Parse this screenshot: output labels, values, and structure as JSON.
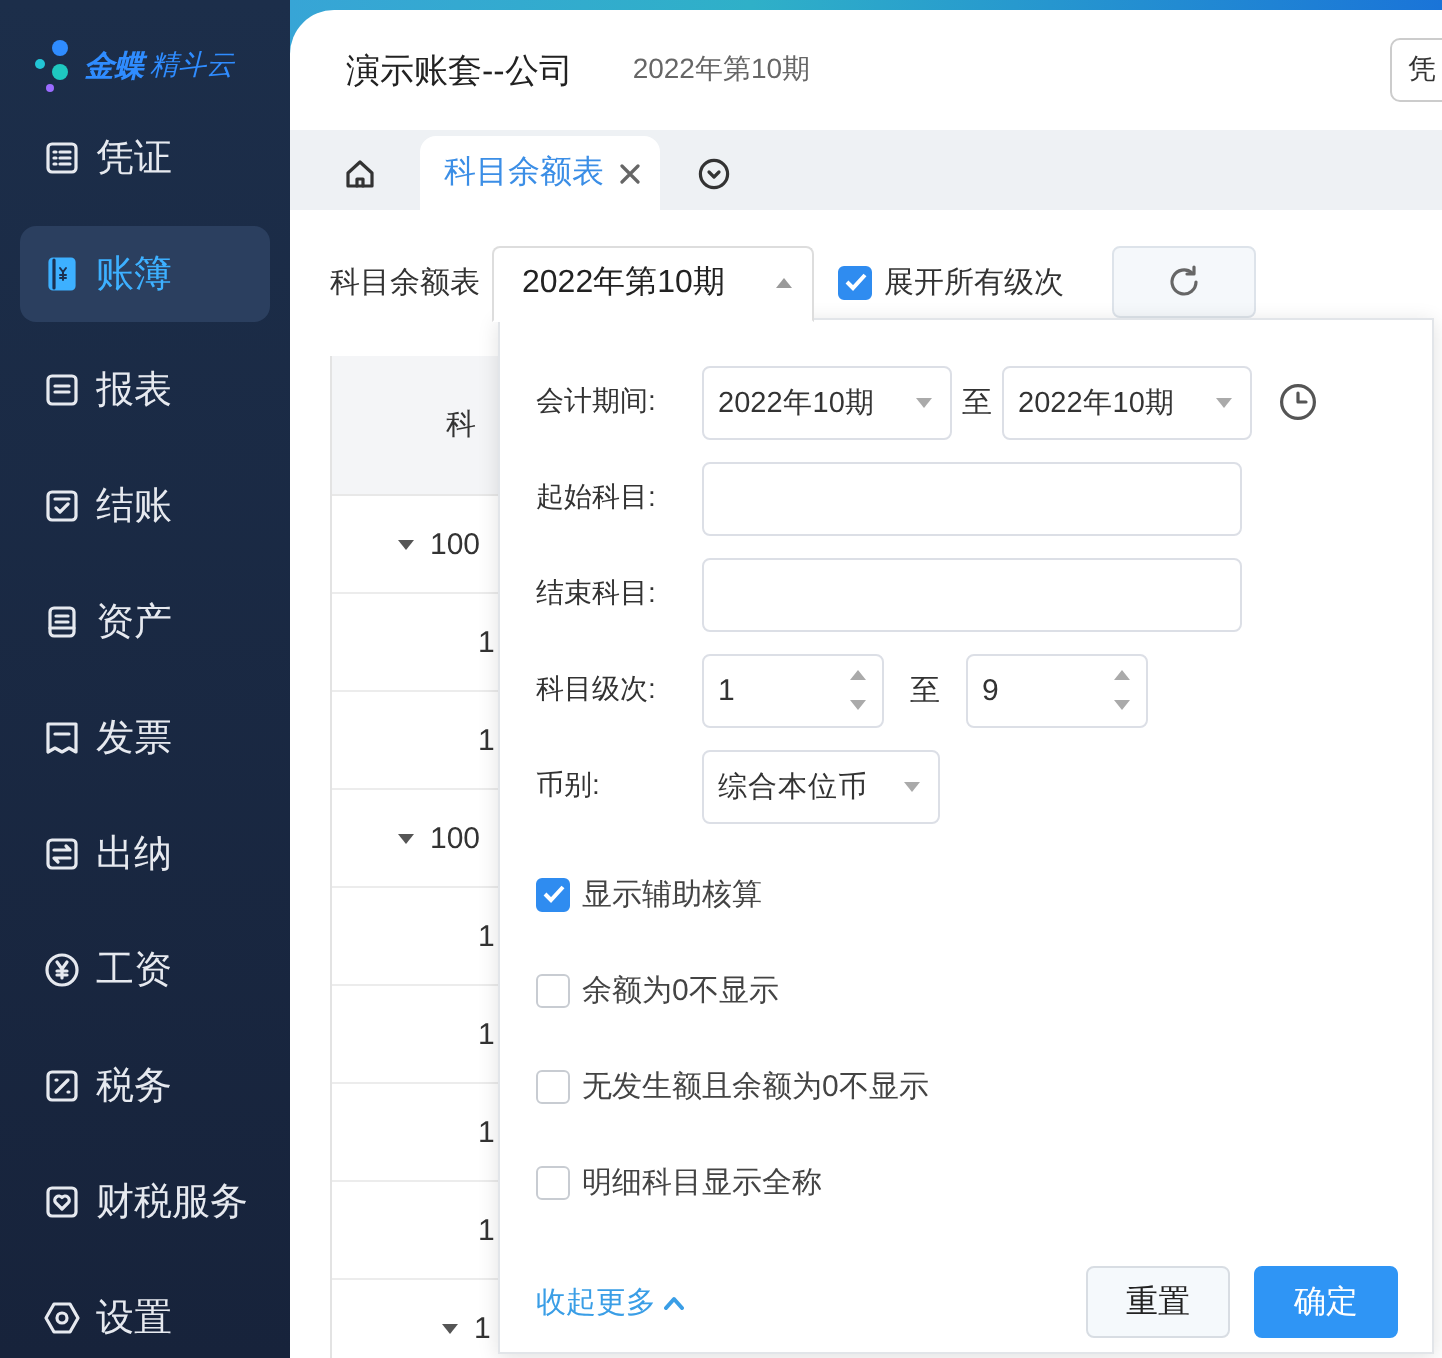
{
  "sidebar": {
    "logo": {
      "brand": "金蝶",
      "product": "精斗云"
    },
    "items": [
      {
        "label": "凭证",
        "kind": "list",
        "selected": false
      },
      {
        "label": "账簿",
        "kind": "book",
        "selected": true
      },
      {
        "label": "报表",
        "kind": "lines",
        "selected": false
      },
      {
        "label": "结账",
        "kind": "check",
        "selected": false
      },
      {
        "label": "资产",
        "kind": "doc",
        "selected": false
      },
      {
        "label": "发票",
        "kind": "receipt",
        "selected": false
      },
      {
        "label": "出纳",
        "kind": "swap",
        "selected": false
      },
      {
        "label": "工资",
        "kind": "yen",
        "selected": false
      },
      {
        "label": "税务",
        "kind": "percent",
        "selected": false
      },
      {
        "label": "财税服务",
        "kind": "heart",
        "selected": false
      },
      {
        "label": "设置",
        "kind": "gear",
        "selected": false
      }
    ]
  },
  "header": {
    "account": "演示账套--公司",
    "period": "2022年第10期",
    "button": "凭"
  },
  "tabs": [
    {
      "kind": "home",
      "selected": false
    },
    {
      "kind": "page",
      "label": "科目余额表",
      "selected": true
    },
    {
      "kind": "more",
      "selected": false
    }
  ],
  "toolbar": {
    "title": "科目余额表",
    "period": {
      "value": "2022年第10期",
      "expanded": true
    },
    "expand_all": {
      "label": "展开所有级次",
      "checked": true
    }
  },
  "table": {
    "columns": [
      "科"
    ],
    "rows": [
      {
        "code": "100",
        "expanded": true,
        "children": [
          {
            "code": "1"
          },
          {
            "code": "1"
          }
        ]
      },
      {
        "code": "100",
        "expanded": true,
        "children": [
          {
            "code": "1"
          },
          {
            "code": "1"
          },
          {
            "code": "1"
          },
          {
            "code": "1"
          },
          {
            "code": "1",
            "expanded": true
          }
        ]
      }
    ]
  },
  "filter_popup": {
    "period": {
      "label": "会计期间:",
      "from": "2022年10期",
      "to_label": "至",
      "to": "2022年10期"
    },
    "start_subject": {
      "label": "起始科目:"
    },
    "end_subject": {
      "label": "结束科目:"
    },
    "level": {
      "label": "科目级次:",
      "from": "1",
      "to_label": "至",
      "to": "9"
    },
    "currency": {
      "label": "币别:",
      "value": "综合本位币"
    },
    "options": [
      {
        "label": "显示辅助核算",
        "checked": true
      },
      {
        "label": "余额为0不显示",
        "checked": false
      },
      {
        "label": "无发生额且余额为0不显示",
        "checked": false
      },
      {
        "label": "明细科目显示全称",
        "checked": false
      }
    ],
    "collapse_link": "收起更多",
    "reset_button": "重置",
    "confirm_button": "确定"
  }
}
